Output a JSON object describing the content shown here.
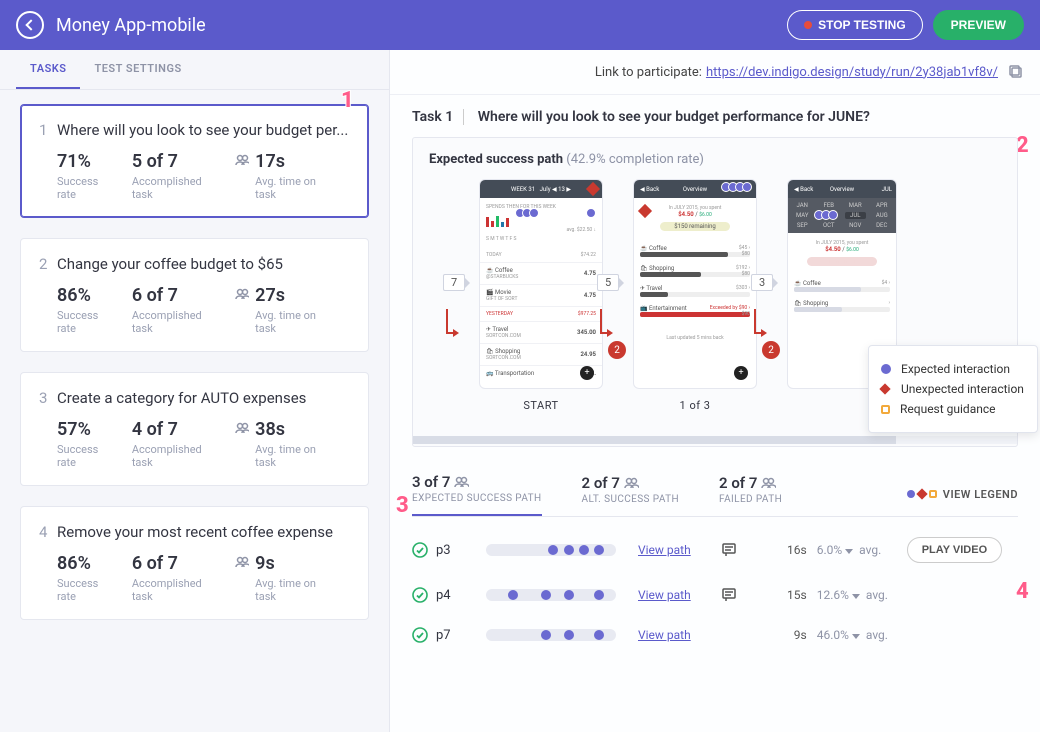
{
  "header": {
    "title": "Money App-mobile",
    "stop_label": "STOP TESTING",
    "preview_label": "PREVIEW"
  },
  "left": {
    "tabs": {
      "tasks": "TASKS",
      "settings": "TEST SETTINGS"
    },
    "tasks": [
      {
        "title": "Where will you look to see your budget per...",
        "rate": "71%",
        "acc": "5 of 7",
        "time": "17s"
      },
      {
        "title": "Change your coffee budget to $65",
        "rate": "86%",
        "acc": "6 of 7",
        "time": "27s"
      },
      {
        "title": "Create a category for AUTO expenses",
        "rate": "57%",
        "acc": "4 of 7",
        "time": "38s"
      },
      {
        "title": "Remove your most recent coffee expense",
        "rate": "86%",
        "acc": "6 of 7",
        "time": "9s"
      }
    ],
    "labels": {
      "rate": "Success rate",
      "acc": "Accomplished task",
      "time": "Avg. time on task"
    }
  },
  "right": {
    "link_label": "Link to participate:",
    "link_url": "https://dev.indigo.design/study/run/2y38jab1vf8v/",
    "task_prefix": "Task 1",
    "task_question": "Where will you look to see your budget performance for JUNE?",
    "path": {
      "title": "Expected success path",
      "rate": "(42.9% completion rate)",
      "steps": [
        {
          "label": "START",
          "chip": "7",
          "bubble": "2"
        },
        {
          "label": "1 of 3",
          "chip": "5",
          "bubble": "2"
        },
        {
          "label": "",
          "chip": "3",
          "bubble": ""
        }
      ]
    },
    "legend": {
      "expected": "Expected interaction",
      "unexpected": "Unexpected interaction",
      "guidance": "Request guidance"
    },
    "result_tabs": [
      {
        "count": "3 of 7",
        "label": "EXPECTED SUCCESS PATH"
      },
      {
        "count": "2 of 7",
        "label": "ALT. SUCCESS PATH"
      },
      {
        "count": "2 of 7",
        "label": "FAILED PATH"
      }
    ],
    "view_legend_label": "VIEW LEGEND",
    "participants": [
      {
        "name": "p3",
        "viewpath": "View path",
        "time": "16s",
        "pct": "6.0%",
        "avg": " avg.",
        "chat": true,
        "play": true,
        "dots": [
          62,
          78,
          93,
          108
        ]
      },
      {
        "name": "p4",
        "viewpath": "View path",
        "time": "15s",
        "pct": "12.6%",
        "avg": " avg.",
        "chat": true,
        "play": false,
        "dots": [
          22,
          55,
          78,
          108
        ]
      },
      {
        "name": "p7",
        "viewpath": "View path",
        "time": "9s",
        "pct": "46.0%",
        "avg": " avg.",
        "chat": false,
        "play": false,
        "dots": [
          55,
          78,
          108
        ]
      }
    ],
    "play_label": "PLAY VIDEO"
  },
  "callouts": [
    "1",
    "2",
    "3",
    "4"
  ]
}
